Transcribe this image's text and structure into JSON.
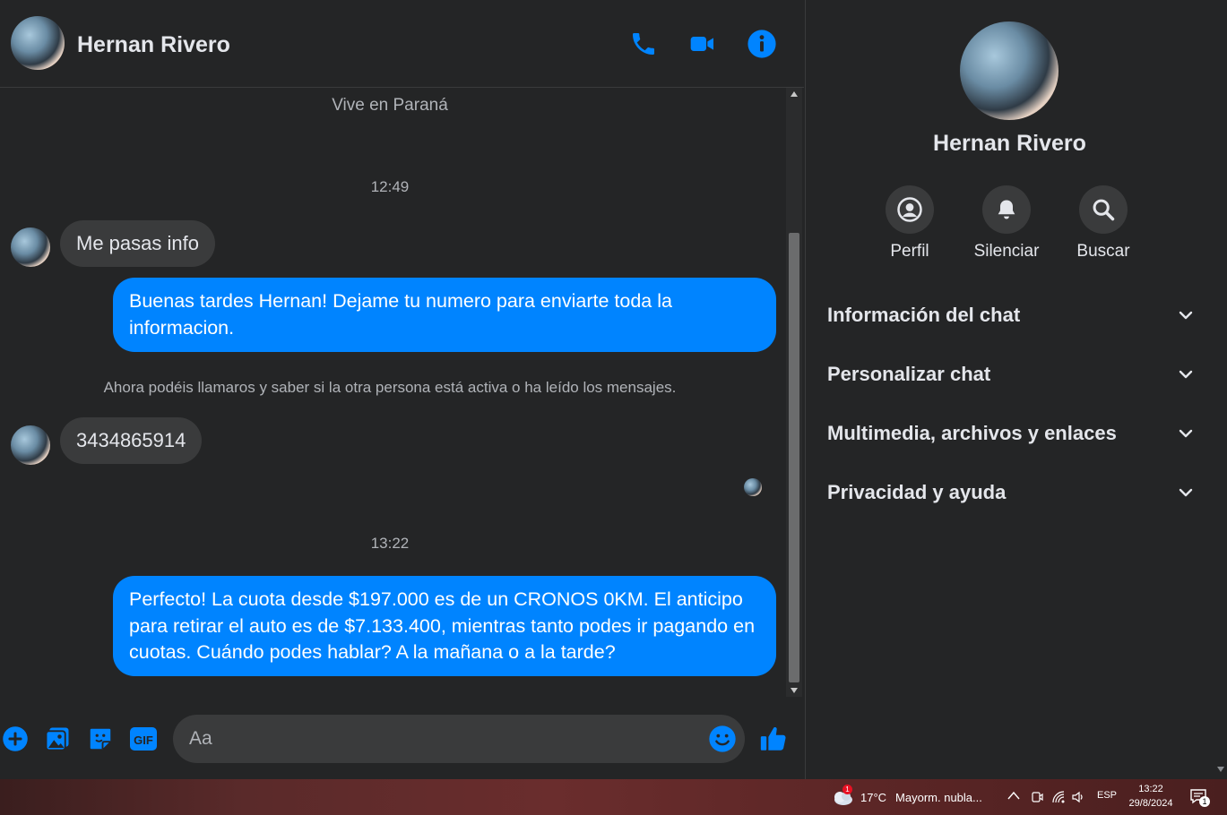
{
  "header": {
    "name": "Hernan Rivero",
    "icons": [
      "phone-icon",
      "video-camera-icon",
      "info-icon"
    ]
  },
  "messages": {
    "location": "Vive en Paraná",
    "time_1": "12:49",
    "incoming_1": "Me pasas info",
    "outgoing_1": "Buenas tardes Hernan! Dejame tu numero para enviarte toda la informacion.",
    "notice": "Ahora podéis llamaros y saber si la otra persona está activa o ha leído los mensajes.",
    "incoming_2": "3434865914",
    "time_2": "13:22",
    "outgoing_2": "Perfecto! La cuota desde $197.000 es de un CRONOS 0KM. El anticipo para retirar el auto es de $7.133.400, mientras tanto podes ir pagando en cuotas. Cuándo podes hablar? A la mañana o a la tarde?"
  },
  "composer": {
    "placeholder": "Aa",
    "icons": [
      "plus-icon",
      "image-icon",
      "sticker-icon",
      "gif-icon",
      "emoji-icon",
      "thumbs-up-icon"
    ],
    "gif_label": "GIF"
  },
  "side_panel": {
    "name": "Hernan Rivero",
    "actions": [
      {
        "label": "Perfil",
        "icon": "profile-icon"
      },
      {
        "label": "Silenciar",
        "icon": "bell-icon"
      },
      {
        "label": "Buscar",
        "icon": "search-icon"
      }
    ],
    "sections": [
      {
        "label": "Información del chat"
      },
      {
        "label": "Personalizar chat"
      },
      {
        "label": "Multimedia, archivos y enlaces"
      },
      {
        "label": "Privacidad y ayuda"
      }
    ]
  },
  "taskbar": {
    "weather_temp": "17°C",
    "weather_desc": "Mayorm. nubla...",
    "weather_badge": "1",
    "language": "ESP",
    "time": "13:22",
    "date": "29/8/2024",
    "notification_count": "1"
  },
  "colors": {
    "accent": "#0084ff",
    "background": "#242526",
    "bubble_incoming": "#3a3b3c"
  }
}
